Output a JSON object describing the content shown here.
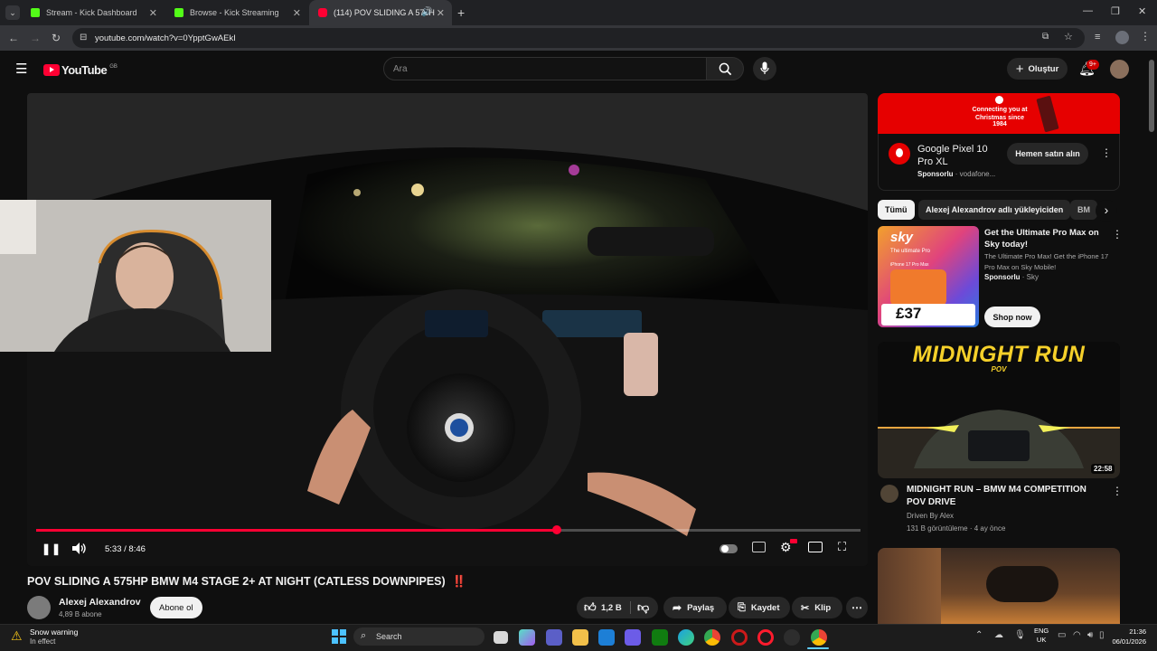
{
  "browser": {
    "tabs": [
      {
        "label": "Stream - Kick Dashboard"
      },
      {
        "label": "Browse - Kick Streaming"
      },
      {
        "label": "(114) POV SLIDING A 575H"
      }
    ],
    "url": "youtube.com/watch?v=0YpptGwAEkI"
  },
  "youtube": {
    "logo_text": "YouTube",
    "region": "GB",
    "search_placeholder": "Ara",
    "create_label": "Oluştur",
    "notif_count": "9+"
  },
  "player": {
    "time": "5:33 / 8:46",
    "progress": 0.632
  },
  "video": {
    "title": "POV SLIDING A 575HP BMW M4 STAGE 2+ AT NIGHT (CATLESS DOWNPIPES)",
    "title_emoji": "‼️",
    "channel": "Alexej Alexandrov",
    "subs": "4,89 B abone",
    "subscribe_label": "Abone ol",
    "likes": "1,2 B",
    "share_label": "Paylaş",
    "save_label": "Kaydet",
    "clip_label": "Klip"
  },
  "sidebar": {
    "banner_line1": "Connecting you at",
    "banner_line2": "Christmas since 1984",
    "ad1": {
      "title": "Google Pixel 10 Pro XL",
      "sponsor": "Sponsorlu",
      "advertiser": "vodafone...",
      "cta": "Hemen satın alın"
    },
    "chips": [
      "Tümü",
      "Alexej Alexandrov adlı yükleyiciden",
      "BM"
    ],
    "ad2": {
      "title": "Get the Ultimate Pro Max on Sky today!",
      "desc": "The Ultimate Pro Max! Get the iPhone 17 Pro Max on Sky Mobile!",
      "sponsor": "Sponsorlu",
      "advertiser": "Sky",
      "cta": "Shop now",
      "thumb_brand": "sky",
      "thumb_headline": "The ultimate Pro",
      "thumb_model": "iPhone 17 Pro Max",
      "thumb_price": "£37"
    },
    "rec1": {
      "thumb_title": "MIDNIGHT RUN",
      "thumb_sub": "POV",
      "duration": "22:58",
      "title": "MIDNIGHT RUN – BMW M4 COMPETITION POV DRIVE",
      "channel": "Driven By Alex",
      "meta": "131 B görüntüleme · 4 ay önce"
    }
  },
  "taskbar": {
    "weather_title": "Snow warning",
    "weather_sub": "In effect",
    "search_label": "Search",
    "lang1": "ENG",
    "lang2": "UK",
    "time": "21:36",
    "date": "06/01/2026"
  },
  "colors": {
    "yt_red": "#ff0033",
    "kick_green": "#53fc18",
    "bg": "#0f0f0f",
    "vodafone_red": "#e60000",
    "sky_blue": "#0072c9"
  }
}
